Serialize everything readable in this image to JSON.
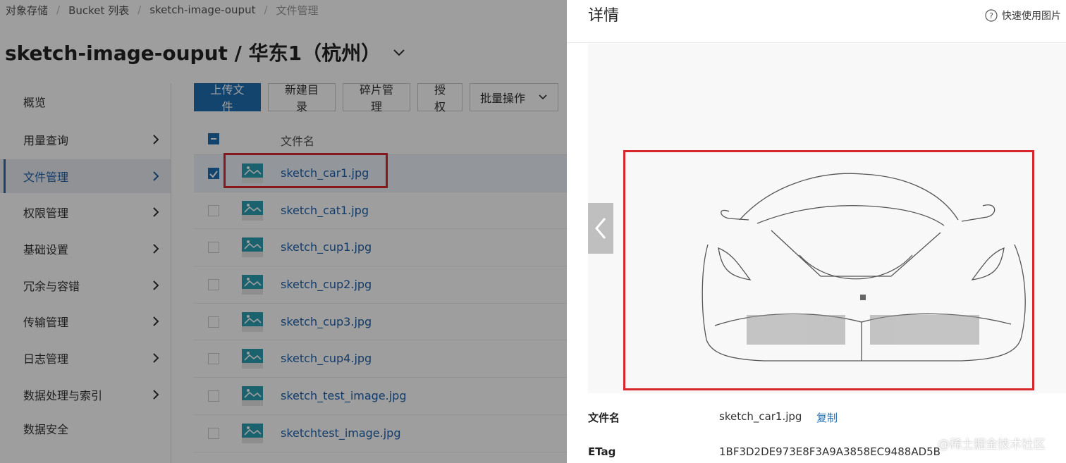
{
  "breadcrumb": {
    "items": [
      "对象存储",
      "Bucket 列表",
      "sketch-image-ouput"
    ],
    "current": "文件管理"
  },
  "page_title": "sketch-image-ouput / 华东1（杭州）",
  "sidebar": {
    "items": [
      {
        "label": "概览"
      },
      {
        "label": "用量查询"
      },
      {
        "label": "文件管理"
      },
      {
        "label": "权限管理"
      },
      {
        "label": "基础设置"
      },
      {
        "label": "冗余与容错"
      },
      {
        "label": "传输管理"
      },
      {
        "label": "日志管理"
      },
      {
        "label": "数据处理与索引"
      },
      {
        "label": "数据安全"
      }
    ]
  },
  "toolbar": {
    "upload": "上传文件",
    "new_dir": "新建目录",
    "fragments": "碎片管理",
    "authorize": "授权",
    "batch": "批量操作"
  },
  "table": {
    "header": "文件名",
    "rows": [
      {
        "name": "sketch_car1.jpg",
        "checked": true
      },
      {
        "name": "sketch_cat1.jpg",
        "checked": false
      },
      {
        "name": "sketch_cup1.jpg",
        "checked": false
      },
      {
        "name": "sketch_cup2.jpg",
        "checked": false
      },
      {
        "name": "sketch_cup3.jpg",
        "checked": false
      },
      {
        "name": "sketch_cup4.jpg",
        "checked": false
      },
      {
        "name": "sketch_test_image.jpg",
        "checked": false
      },
      {
        "name": "sketchtest_image.jpg",
        "checked": false
      }
    ]
  },
  "drawer": {
    "title": "详情",
    "help": "快速使用图片",
    "filename_label": "文件名",
    "filename_value": "sketch_car1.jpg",
    "copy": "复制",
    "etag_label": "ETag",
    "etag_value": "1BF3D2DE973E8F3A9A3858EC9488AD5B"
  },
  "watermark": "@稀土掘金技术社区",
  "colors": {
    "primary": "#1f6fb2",
    "link": "#1f5fa8",
    "highlight": "#d9262c",
    "overlay": "rgba(0,0,0,0.38)"
  }
}
